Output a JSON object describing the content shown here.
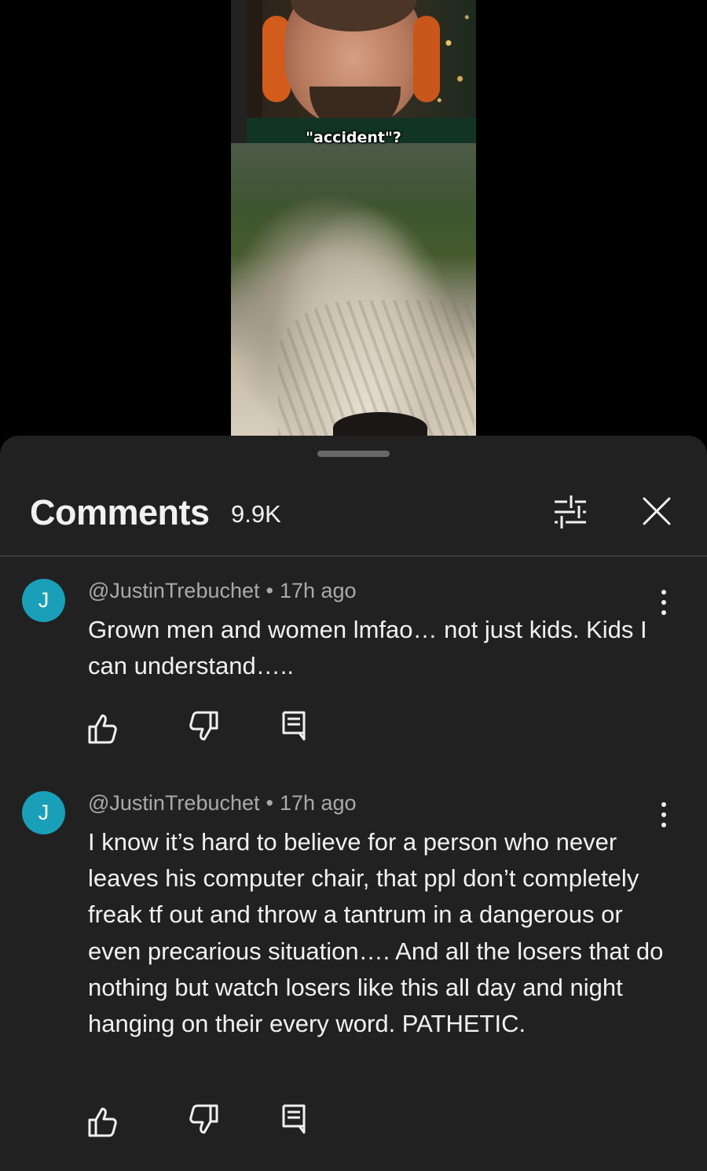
{
  "video": {
    "caption": "\"accident\"?"
  },
  "comments_panel": {
    "title": "Comments",
    "count": "9.9K",
    "icons": {
      "filter": "sort-filter-icon",
      "close": "close-icon"
    },
    "comments": [
      {
        "avatar_letter": "J",
        "author": "@JustinTrebuchet",
        "separator": "•",
        "time": "17h ago",
        "text": "Grown men and women lmfao… not just kids. Kids I can understand…..",
        "actions": [
          "like-icon",
          "dislike-icon",
          "reply-icon"
        ]
      },
      {
        "avatar_letter": "J",
        "author": "@JustinTrebuchet",
        "separator": "•",
        "time": "17h ago",
        "text": "I know it’s hard to believe for a person who never leaves his computer chair, that ppl don’t completely freak tf out and throw a tantrum in a dangerous or even precarious situation…. And all the losers that do nothing but watch losers like this all day and night hanging on their every word. PATHETIC.",
        "actions": [
          "like-icon",
          "dislike-icon",
          "reply-icon"
        ]
      }
    ]
  },
  "colors": {
    "sheet_background": "#212121",
    "avatar": "#1a9fb8",
    "text_primary": "#f1f1f1",
    "text_secondary": "#aaaaaa"
  }
}
